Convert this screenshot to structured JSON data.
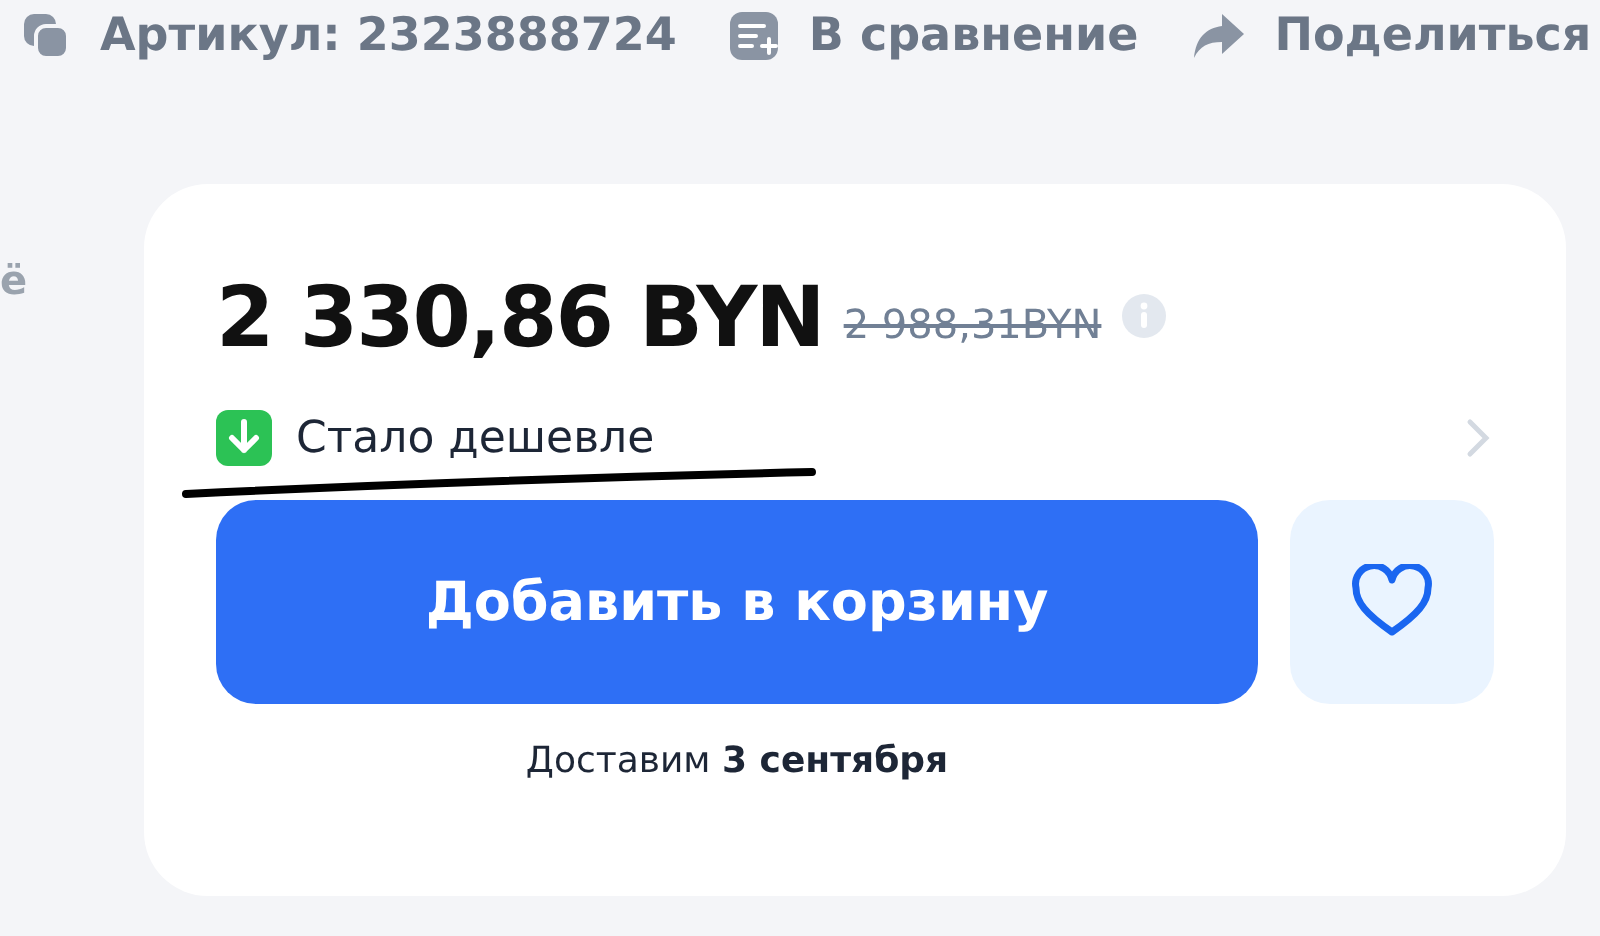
{
  "actions": [
    {
      "kind": "copy",
      "label": "Артикул: 2323888724"
    },
    {
      "kind": "compare",
      "label": "В сравнение"
    },
    {
      "kind": "share",
      "label": "Поделиться"
    }
  ],
  "side_text": "ё",
  "price": {
    "current": "2 330,86 BYN",
    "old": "2 988,31BYN"
  },
  "price_note": "Стало дешевле",
  "cart_button": "Добавить в корзину",
  "favorite": {
    "selected": false
  },
  "delivery": "Доставим **3 сентября**"
}
